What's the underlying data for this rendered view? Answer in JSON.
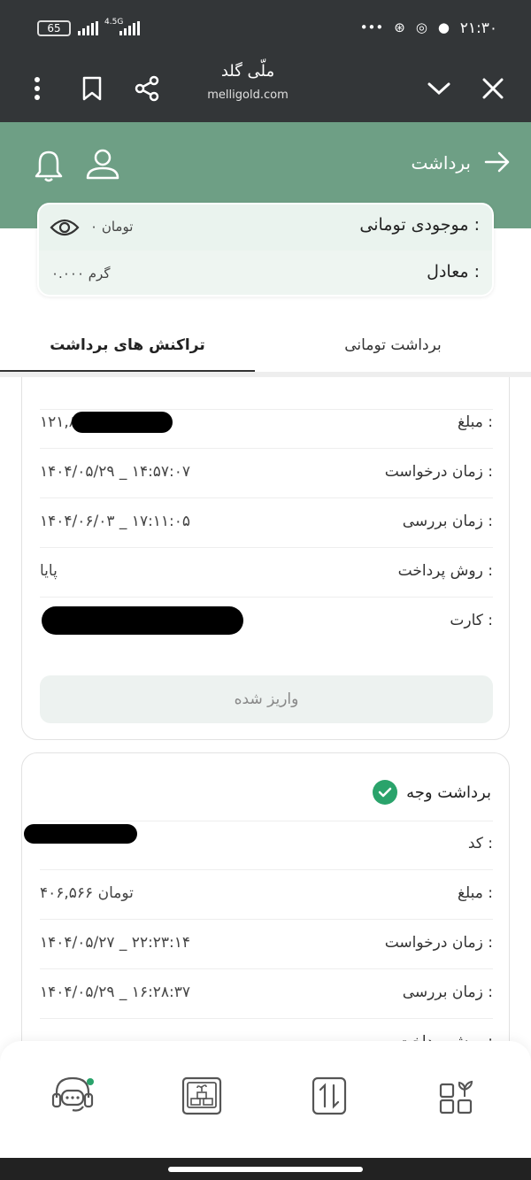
{
  "status_bar": {
    "time": "۲۱:۳۰",
    "battery": "65",
    "network": "4.5G",
    "dots": "•••"
  },
  "browser": {
    "site_title": "ملّی گلد",
    "site_url": "melligold.com"
  },
  "header": {
    "page_title": "برداشت"
  },
  "balance": {
    "toman_label": "موجودی تومانی :",
    "toman_value": "۰ تومان",
    "equivalent_label": "معادل :",
    "equivalent_value": "۰.۰۰۰ گرم"
  },
  "tabs": {
    "transactions": "تراکنش های برداشت",
    "toman_withdraw": "برداشت تومانی"
  },
  "card1": {
    "amount_label": "مبلغ :",
    "amount_value": "۱۲۱,۸۵۸ تومان",
    "request_time_label": "زمان درخواست :",
    "request_time_value": "۱۴۰۴/۰۵/۲۹ _ ۱۴:۵۷:۰۷",
    "review_time_label": "زمان بررسی :",
    "review_time_value": "۱۴۰۴/۰۶/۰۳ _ ۱۷:۱۱:۰۵",
    "payment_method_label": "روش پرداخت :",
    "payment_method_value": "پایا",
    "card_label": "کارت :",
    "card_value": "",
    "status_button": "واریز شده"
  },
  "card2": {
    "title": "برداشت وجه",
    "code_label": "کد :",
    "code_value": "",
    "amount_label": "مبلغ :",
    "amount_value": "۴۰۶,۵۶۶ تومان",
    "request_time_label": "زمان درخواست :",
    "request_time_value": "۱۴۰۴/۰۵/۲۷ _ ۲۲:۲۳:۱۴",
    "review_time_label": "زمان بررسی :",
    "review_time_value": "۱۴۰۴/۰۵/۲۹ _ ۱۶:۲۸:۳۷",
    "payment_method_label": "روش پرداخت :"
  },
  "bottom_nav": {
    "items": [
      "support-icon",
      "gold-box-icon",
      "transfer-icon",
      "dashboard-icon"
    ]
  },
  "colors": {
    "header_green": "#6e9f85",
    "success_green": "#2aa36b",
    "dark_bar": "#333638"
  }
}
